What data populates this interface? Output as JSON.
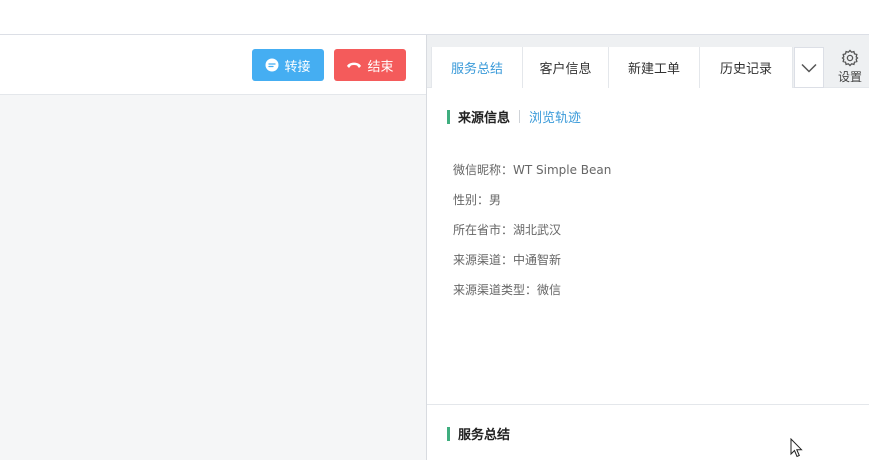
{
  "toolbar": {
    "transfer_label": "转接",
    "end_label": "结束"
  },
  "tabs": [
    {
      "label": "服务总结",
      "active": true
    },
    {
      "label": "客户信息",
      "active": false
    },
    {
      "label": "新建工单",
      "active": false
    },
    {
      "label": "历史记录",
      "active": false
    }
  ],
  "settings": {
    "label": "设置",
    "icon": "gear-icon"
  },
  "source_section": {
    "title": "来源信息",
    "link": "浏览轨迹",
    "rows": [
      "微信昵称：WT Simple Bean",
      "性别：男",
      "所在省市：湖北武汉",
      "来源渠道：中通智新",
      "来源渠道类型：微信"
    ]
  },
  "summary_section": {
    "title": "服务总结"
  },
  "colors": {
    "transfer_button": "#45aef2",
    "end_button": "#f45b5b",
    "active_tab": "#3a9ad9",
    "section_bar": "#3fae7f"
  }
}
